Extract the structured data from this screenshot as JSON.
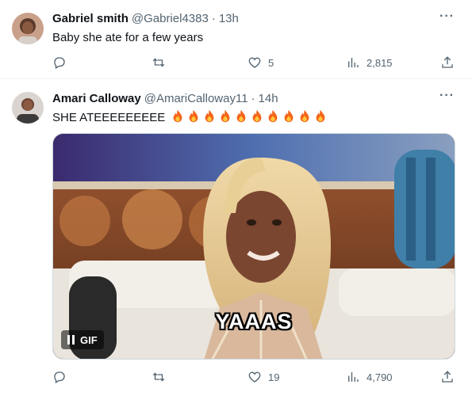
{
  "tweets": [
    {
      "author_name": "Gabriel smith",
      "author_handle": "@Gabriel4383",
      "separator": "·",
      "time": "13h",
      "text": "Baby she ate for a few years",
      "reply_count": "",
      "retweet_count": "",
      "like_count": "5",
      "view_count": "2,815",
      "more_label": "···"
    },
    {
      "author_name": "Amari Calloway",
      "author_handle": "@AmariCalloway11",
      "separator": "·",
      "time": "14h",
      "text": "SHE ATEEEEEEEEE",
      "emoji_count": 10,
      "emoji_name": "fire-emoji",
      "media": {
        "type": "gif",
        "caption": "YAAAS",
        "badge_label": "GIF"
      },
      "reply_count": "",
      "retweet_count": "",
      "like_count": "19",
      "view_count": "4,790",
      "more_label": "···"
    }
  ],
  "icons": {
    "reply": "reply-icon",
    "retweet": "retweet-icon",
    "like": "like-icon",
    "views": "views-icon",
    "share": "share-icon",
    "more": "more-icon",
    "pause": "pause-icon"
  },
  "colors": {
    "text_primary": "#0f1419",
    "text_secondary": "#536471",
    "divider": "#eff3f4"
  }
}
